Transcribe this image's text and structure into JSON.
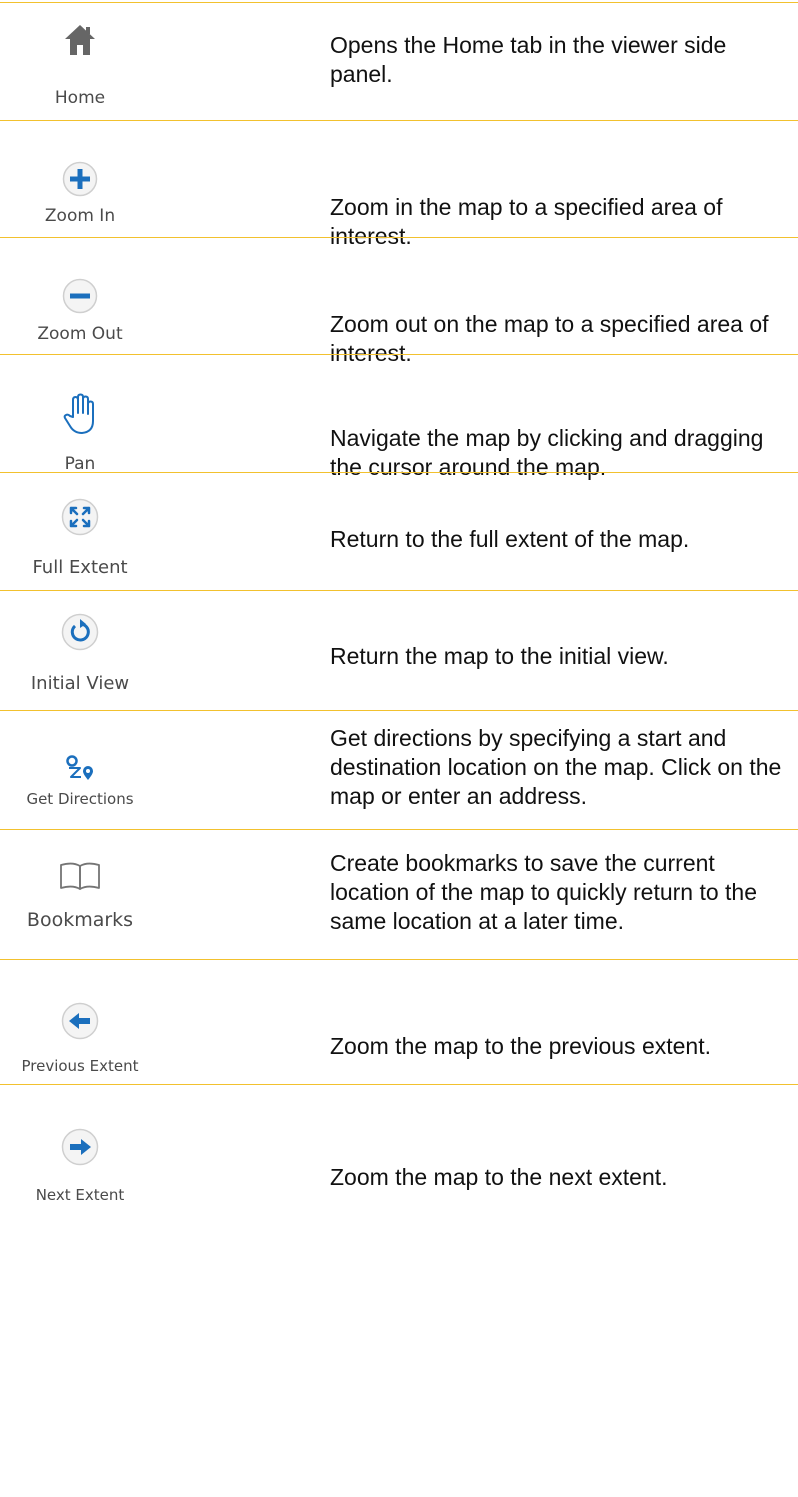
{
  "colors": {
    "rule": "#f2c12e",
    "icon_blue": "#1b6fbd",
    "icon_gray": "#757575",
    "label_text": "#4a4a4a",
    "desc_text": "#111111"
  },
  "tools": [
    {
      "icon": "home-icon",
      "label": "Home",
      "description": "Opens the Home tab in the viewer side panel."
    },
    {
      "icon": "zoom-in-icon",
      "label": "Zoom In",
      "description": "Zoom in the map to a specified area of interest."
    },
    {
      "icon": "zoom-out-icon",
      "label": "Zoom Out",
      "description": "Zoom out on the map to a specified area of interest."
    },
    {
      "icon": "pan-hand-icon",
      "label": "Pan",
      "description": "Navigate the map by clicking and dragging the cursor around the map."
    },
    {
      "icon": "full-extent-icon",
      "label": "Full Extent",
      "description": "Return to the full extent of the map."
    },
    {
      "icon": "initial-view-icon",
      "label": "Initial View",
      "description": "Return the map to the initial view."
    },
    {
      "icon": "directions-icon",
      "label": "Get Directions",
      "description": "Get directions by specifying a start and destination location on the map. Click on the map or enter an address."
    },
    {
      "icon": "bookmarks-icon",
      "label": "Bookmarks",
      "description": "Create bookmarks to save the current location of the map to quickly return to the same location at a later time."
    },
    {
      "icon": "previous-extent-icon",
      "label": "Previous Extent",
      "description": "Zoom the map to the previous extent."
    },
    {
      "icon": "next-extent-icon",
      "label": "Next Extent",
      "description": "Zoom the map to the next extent."
    }
  ]
}
